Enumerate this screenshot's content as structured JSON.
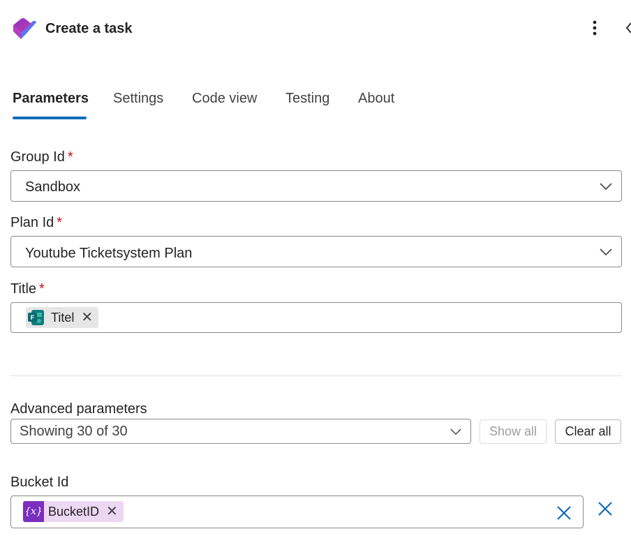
{
  "header": {
    "title": "Create a task",
    "logo_icon": "planner-logo-icon",
    "more_icon": "more-vertical-icon",
    "collapse_icon": "chevron-left-icon"
  },
  "tabs": [
    {
      "label": "Parameters",
      "active": true
    },
    {
      "label": "Settings",
      "active": false
    },
    {
      "label": "Code view",
      "active": false
    },
    {
      "label": "Testing",
      "active": false
    },
    {
      "label": "About",
      "active": false
    }
  ],
  "fields": {
    "group_id": {
      "label": "Group Id",
      "required_mark": "*",
      "value": "Sandbox"
    },
    "plan_id": {
      "label": "Plan Id",
      "required_mark": "*",
      "value": "Youtube Ticketsystem Plan"
    },
    "title": {
      "label": "Title",
      "required_mark": "*",
      "token": {
        "text": "Titel",
        "icon": "forms-icon",
        "remove": "✕"
      }
    }
  },
  "advanced": {
    "label": "Advanced parameters",
    "dropdown_value": "Showing 30 of 30",
    "show_all_label": "Show all",
    "clear_all_label": "Clear all"
  },
  "bucket_id": {
    "label": "Bucket Id",
    "token": {
      "text": "BucketID",
      "icon": "variable-icon",
      "icon_text": "{x}",
      "remove": "✕"
    },
    "clear_icon": "close-icon",
    "remove_param_icon": "close-icon"
  },
  "colors": {
    "accent": "#0f6cbd",
    "required": "#c50f1f",
    "variable_token_bg": "#ecd8f2",
    "variable_icon_bg": "#7b2fbf"
  }
}
